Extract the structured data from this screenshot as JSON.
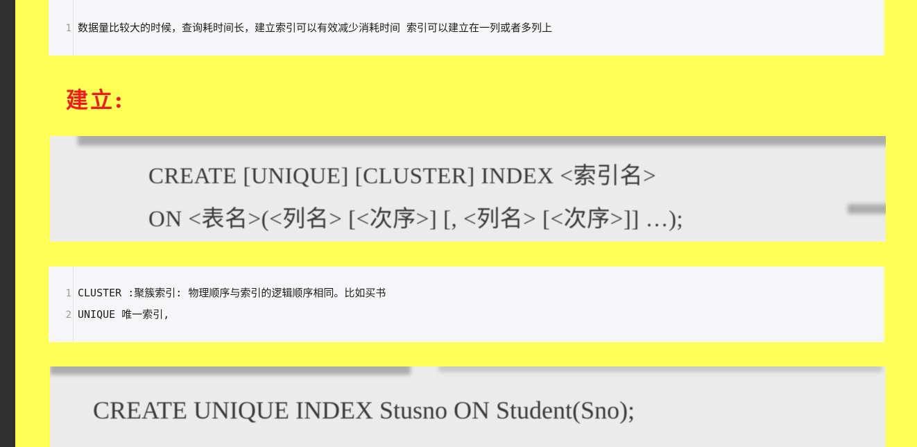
{
  "top_code": {
    "lines": [
      {
        "no": "1",
        "text": "数据量比较大的时候，查询耗时间长，建立索引可以有效减少消耗时间     索引可以建立在一列或者多列上"
      }
    ]
  },
  "heading": "建立:",
  "syntax_scan": {
    "lines": [
      "CREATE [UNIQUE] [CLUSTER] INDEX <索引名>",
      "ON <表名>(<列名> [<次序>] [, <列名> [<次序>]] …);"
    ]
  },
  "notes_code": {
    "lines": [
      {
        "no": "1",
        "text": "CLUSTER :聚簇索引:  物理顺序与索引的逻辑顺序相同。比如买书"
      },
      {
        "no": "2",
        "text": "UNIQUE 唯一索引,"
      }
    ]
  },
  "example_scan": {
    "line": "CREATE UNIQUE INDEX Stusno ON Student(Sno);"
  },
  "colors": {
    "page_background": "#ffff55",
    "heading": "#ee1c1c",
    "code_background": "#f6f6f8",
    "scan_background": "#ebebeb"
  }
}
